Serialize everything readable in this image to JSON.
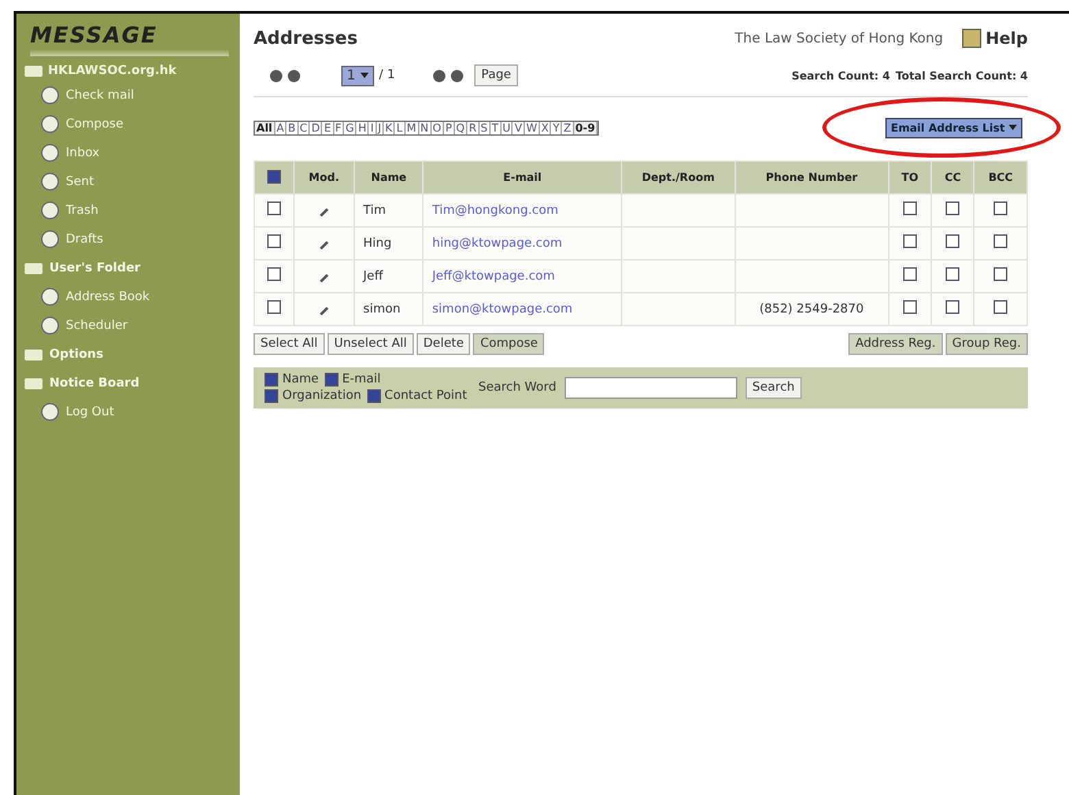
{
  "logo": "MESSAGE",
  "sidebar": {
    "account": "HKLAWSOC.org.hk",
    "items": [
      {
        "label": "Check mail",
        "kind": "item"
      },
      {
        "label": "Compose",
        "kind": "item"
      },
      {
        "label": "Inbox",
        "kind": "item"
      },
      {
        "label": "Sent",
        "kind": "item"
      },
      {
        "label": "Trash",
        "kind": "item"
      },
      {
        "label": "Drafts",
        "kind": "item"
      },
      {
        "label": "User's Folder",
        "kind": "folder"
      },
      {
        "label": "Address Book",
        "kind": "item"
      },
      {
        "label": "Scheduler",
        "kind": "item"
      },
      {
        "label": "Options",
        "kind": "folder"
      },
      {
        "label": "Notice Board",
        "kind": "folder"
      },
      {
        "label": "Log Out",
        "kind": "item"
      }
    ]
  },
  "header": {
    "title": "Addresses",
    "organization": "The Law Society of Hong Kong",
    "help": "Help"
  },
  "pager": {
    "page": "1",
    "total": "/ 1",
    "go": "Page",
    "search_count": "Search Count: 4",
    "total_count": "Total Search Count: 4"
  },
  "alphabet": [
    "All",
    "A",
    "B",
    "C",
    "D",
    "E",
    "F",
    "G",
    "H",
    "I",
    "J",
    "K",
    "L",
    "M",
    "N",
    "O",
    "P",
    "Q",
    "R",
    "S",
    "T",
    "U",
    "V",
    "W",
    "X",
    "Y",
    "Z",
    "0-9"
  ],
  "list_select": "Email Address List",
  "table": {
    "header_checked": true,
    "columns": [
      "Mod.",
      "Name",
      "E-mail",
      "Dept./Room",
      "Phone Number",
      "TO",
      "CC",
      "BCC"
    ],
    "rows": [
      {
        "checked": false,
        "name": "Tim",
        "email": "Tim@hongkong.com",
        "dept": "",
        "phone": "",
        "to": false,
        "cc": false,
        "bcc": false
      },
      {
        "checked": false,
        "name": "Hing",
        "email": "hing@ktowpage.com",
        "dept": "",
        "phone": "",
        "to": false,
        "cc": false,
        "bcc": false
      },
      {
        "checked": false,
        "name": "Jeff",
        "email": "Jeff@ktowpage.com",
        "dept": "",
        "phone": "",
        "to": false,
        "cc": false,
        "bcc": false
      },
      {
        "checked": false,
        "name": "simon",
        "email": "simon@ktowpage.com",
        "dept": "",
        "phone": "(852) 2549-2870",
        "to": false,
        "cc": false,
        "bcc": false
      }
    ]
  },
  "actions": [
    "Select All",
    "Unselect All",
    "Delete",
    "Compose"
  ],
  "reg_buttons": [
    "Address Reg.",
    "Group Reg."
  ],
  "search": {
    "options": [
      {
        "label": "Name",
        "checked": true
      },
      {
        "label": "E-mail",
        "checked": true
      },
      {
        "label": "Organization",
        "checked": true
      },
      {
        "label": "Contact Point",
        "checked": true
      }
    ],
    "label": "Search Word",
    "button": "Search"
  }
}
